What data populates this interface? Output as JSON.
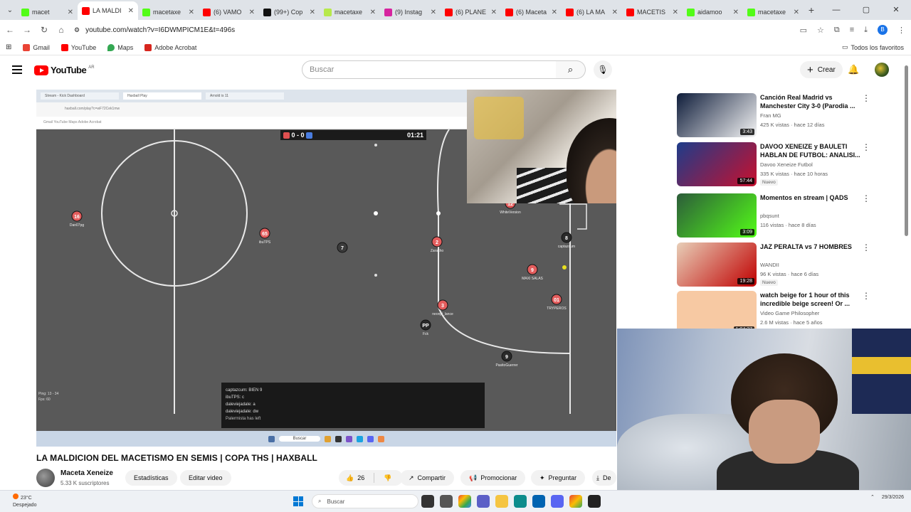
{
  "browser": {
    "tabs": [
      {
        "title": "macet",
        "color": "#53fc18",
        "active": false
      },
      {
        "title": "LA MALDI",
        "color": "#ff0000",
        "active": true
      },
      {
        "title": "macetaxe",
        "color": "#53fc18",
        "active": false
      },
      {
        "title": "(6) VAMO",
        "color": "#ff0000",
        "active": false
      },
      {
        "title": "(99+) Cop",
        "color": "#111111",
        "active": false
      },
      {
        "title": "macetaxe",
        "color": "#b7e94c",
        "active": false
      },
      {
        "title": "(9) Instag",
        "color": "#d6249f",
        "active": false
      },
      {
        "title": "(6) PLANE",
        "color": "#ff0000",
        "active": false
      },
      {
        "title": "(6) Maceta",
        "color": "#ff0000",
        "active": false
      },
      {
        "title": "(6) LA MA",
        "color": "#ff0000",
        "active": false
      },
      {
        "title": "MACETIS",
        "color": "#ff0000",
        "active": false
      },
      {
        "title": "aidamoo",
        "color": "#53fc18",
        "active": false
      },
      {
        "title": "macetaxe",
        "color": "#53fc18",
        "active": false
      }
    ],
    "url": "youtube.com/watch?v=I6DWMPICM1E&t=496s",
    "bookmarks": [
      "Gmail",
      "YouTube",
      "Maps",
      "Adobe Acrobat"
    ],
    "bookmarks_right": "Todos los favoritos"
  },
  "youtube": {
    "logo_text": "YouTube",
    "region": "AR",
    "search_placeholder": "Buscar",
    "create_label": "Crear"
  },
  "player": {
    "score": "0 - 0",
    "timer": "01:21",
    "inner_tabs": [
      "Stream - Kick Dashboard",
      "Haxball Play",
      "Arnold is 11"
    ],
    "inner_url": "haxball.com/play?c=wF72Cek1mw",
    "inner_bookmarks": "Gmail   YouTube   Maps   Adobe Acrobat",
    "ping": "Ping: 13 - 34",
    "fps": "Fps: 60",
    "chat": [
      "captazcum: BIEN 9",
      "ibuTPS: c",
      "daleviejadale: a",
      "daleviejadale: dw",
      "Palermista has left"
    ],
    "players": [
      {
        "num": "16",
        "name": "Dan07pg",
        "team": "red"
      },
      {
        "num": "65",
        "name": "ibuTPS",
        "team": "red"
      },
      {
        "num": "7",
        "name": "",
        "team": "gray"
      },
      {
        "num": "2",
        "name": "Zaraltho",
        "team": "red"
      },
      {
        "num": "12",
        "name": "WhiteVersion",
        "team": "red"
      },
      {
        "num": "8",
        "name": "captazcum",
        "team": "dark"
      },
      {
        "num": "9",
        "name": "MAXI SALAS",
        "team": "red"
      },
      {
        "num": "01",
        "name": "TRYPEROS",
        "team": "red"
      },
      {
        "num": "3",
        "name": "neonjit_lance",
        "team": "red"
      },
      {
        "num": "PP",
        "name": "Fck",
        "team": "dark"
      },
      {
        "num": "9",
        "name": "PasitoGuerrer",
        "team": "dark"
      }
    ]
  },
  "video": {
    "title": "LA MALDICION DEL MACETISMO EN SEMIS | COPA THS | HAXBALL",
    "channel": "Maceta Xeneize",
    "subscribers": "5.33 K suscriptores",
    "buttons": {
      "stats": "Estadísticas",
      "edit": "Editar video",
      "likes": "26",
      "share": "Compartir",
      "promote": "Promocionar",
      "ask": "Preguntar",
      "download": "De"
    }
  },
  "recommendations": [
    {
      "title": "Canción Real Madrid vs Manchester City 3-0 (Parodia ...",
      "channel": "Fran MG",
      "meta": "425 K vistas · hace 12 días",
      "duration": "3:43",
      "badge": "",
      "thumb": [
        "#0e1c3a",
        "#f5f5f5"
      ]
    },
    {
      "title": "DAVOO XENEIZE y BAULETI HABLAN DE FUTBOL: ANALISI...",
      "channel": "Davoo Xeneize Futbol",
      "meta": "335 K vistas · hace 10 horas",
      "duration": "57:44",
      "badge": "Nuevo",
      "thumb": [
        "#1d3c8a",
        "#c8102e"
      ]
    },
    {
      "title": "Momentos en stream | QADS",
      "channel": "pbqsunt",
      "meta": "116 vistas · hace 8 días",
      "duration": "3:09",
      "badge": "",
      "thumb": [
        "#2c5c3a",
        "#53fc18"
      ]
    },
    {
      "title": "JAZ PERALTA vs 7 HOMBRES",
      "channel": "WANDII",
      "meta": "96 K vistas · hace 6 días",
      "duration": "19:28",
      "badge": "Nuevo",
      "thumb": [
        "#e8cfb8",
        "#c00000"
      ]
    },
    {
      "title": "watch beige for 1 hour of this incredible beige screen! Or ...",
      "channel": "Video Game Philosopher",
      "meta": "2.6 M vistas · hace 5 años",
      "duration": "1:04:27",
      "badge": "",
      "thumb": [
        "#f7c9a3",
        "#f7c9a3"
      ]
    }
  ],
  "taskbar": {
    "temperature": "23°C",
    "weather": "Despejado",
    "search": "Buscar",
    "time": "",
    "date": "29/3/2026"
  }
}
